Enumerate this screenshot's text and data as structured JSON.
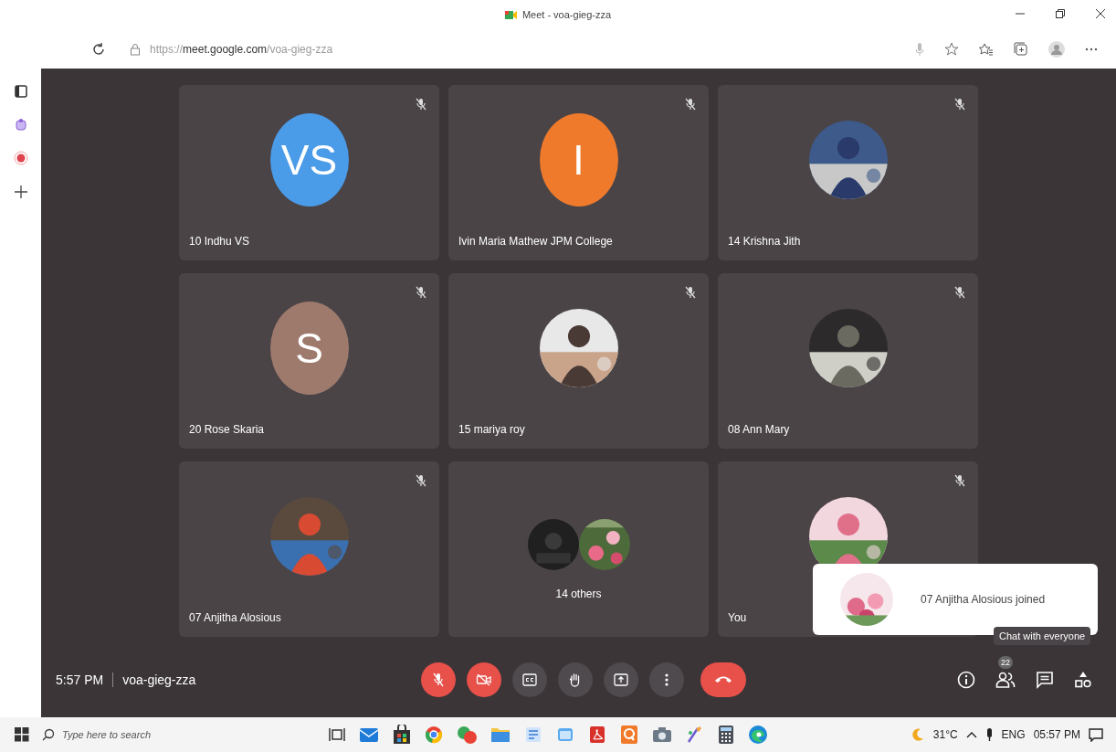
{
  "window": {
    "title": "Meet - voa-gieg-zza"
  },
  "address_bar": {
    "scheme": "https://",
    "host": "meet.google.com",
    "path": "/voa-gieg-zza"
  },
  "tiles": [
    {
      "kind": "letter",
      "name": "10 Indhu VS",
      "initials": "VS",
      "color": "#4a9be8",
      "muted": true
    },
    {
      "kind": "letter",
      "name": "Ivin Maria Mathew JPM College",
      "initials": "I",
      "color": "#ef7a2b",
      "muted": true
    },
    {
      "kind": "picture",
      "name": "14 Krishna Jith",
      "muted": true
    },
    {
      "kind": "letter",
      "name": "20 Rose Skaria",
      "initials": "S",
      "color": "#9e7a6d",
      "muted": true
    },
    {
      "kind": "picture",
      "name": "15 mariya roy",
      "muted": true
    },
    {
      "kind": "picture",
      "name": "08 Ann Mary",
      "muted": true
    },
    {
      "kind": "picture",
      "name": "07 Anjitha Alosious",
      "muted": true
    },
    {
      "kind": "group",
      "name": "14 others",
      "muted": false
    },
    {
      "kind": "picture",
      "name": "You",
      "muted": true
    }
  ],
  "toast": {
    "text": "07 Anjitha Alosious joined"
  },
  "tooltip": {
    "text": "Chat with everyone"
  },
  "meeting_bar": {
    "time": "5:57 PM",
    "code": "voa-gieg-zza",
    "mic_on": false,
    "camera_on": false,
    "participants_badge": "22"
  },
  "taskbar": {
    "search_placeholder": "Type here to search",
    "temperature": "31°C",
    "language": "ENG",
    "clock": "05:57 PM"
  }
}
